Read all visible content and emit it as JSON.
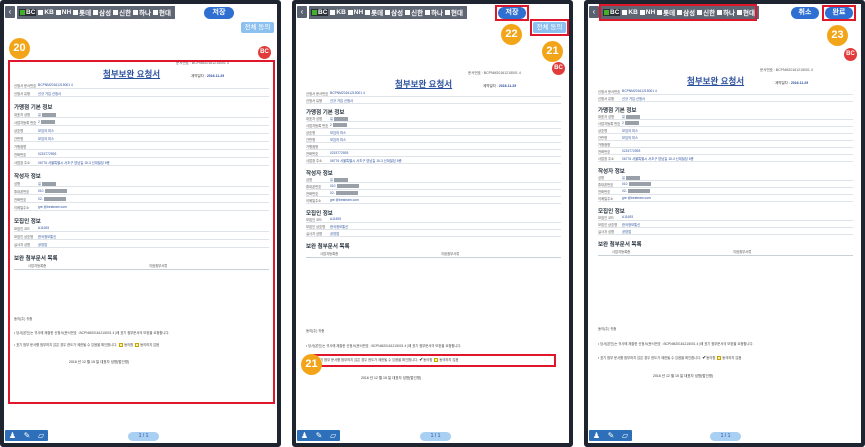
{
  "tabs": [
    {
      "label": "BC",
      "color": "#43b02a"
    },
    {
      "label": "KB",
      "color": "#ffffff"
    },
    {
      "label": "NH",
      "color": "#ffffff"
    },
    {
      "label": "롯데",
      "color": "#ffffff"
    },
    {
      "label": "삼성",
      "color": "#ffffff"
    },
    {
      "label": "신한",
      "color": "#ffffff"
    },
    {
      "label": "하나",
      "color": "#ffffff"
    },
    {
      "label": "현대",
      "color": "#ffffff"
    }
  ],
  "buttons": {
    "save": "저장",
    "agree_all": "전체 동의",
    "cancel": "취소",
    "done": "완료"
  },
  "logo_text": "BC",
  "doc": {
    "number": "문서번호 : BCPNM20161215001 4",
    "title": "첨부보완 요청서",
    "date_label": "계약일자 :",
    "date_value": "2016.11.29",
    "head_rows": [
      {
        "label": "신청서 문서번호",
        "value": "BCPNM20161215001 4"
      },
      {
        "label": "신청서 유형",
        "value": "신규 가입 신청서"
      }
    ],
    "sections": [
      {
        "title": "가맹점 기본 정보",
        "rows": [
          {
            "label": "대표자 성명",
            "value": "유"
          },
          {
            "label": "사업자등록 번호",
            "value": "2"
          },
          {
            "label": "상호명",
            "value": "모임의 미스"
          },
          {
            "label": "간판명",
            "value": "모임의 미스"
          },
          {
            "label": "가맹점명",
            "value": ""
          },
          {
            "label": "전화번호",
            "value": "0215772593"
          },
          {
            "label": "사업장 주소",
            "value": "06776   서울특별시 서초구 양남길 15-3              신대빌딩 5층"
          }
        ]
      },
      {
        "title": "작성자 정보",
        "rows": [
          {
            "label": "성명",
            "value": "유"
          },
          {
            "label": "휴대폰번호",
            "value": "010"
          },
          {
            "label": "전화번호",
            "value": "02-"
          },
          {
            "label": "이메일주소",
            "value": "gre          @besteam.com"
          }
        ]
      },
      {
        "title": "모집인 정보",
        "rows": [
          {
            "label": "모집인 코드",
            "value": "A11693"
          },
          {
            "label": "모집인 상호명",
            "value": "한국정보통신"
          },
          {
            "label": "실사자 성명",
            "value": "공영업"
          }
        ]
      },
      {
        "title": "보완 첨부문서 목록",
        "rows": [
          {
            "label": "사업자등록증",
            "value": "지점첨부서류"
          }
        ]
      }
    ],
    "consent_head": "동의(주) 귀중",
    "consent_line1": "• 당사(본인)는 귀사에 제출한 신청서(문서번호 : BCPNM20161215001 4        )에 표기 첨부문서의 보완을 요청합니다.",
    "consent_line2": "• 표기 첨부 문서를 첨부하지 않은 경우 한도가 제한될 수 있음을 확인합니다.",
    "agree": "동의함",
    "disagree": "동의하지 않음",
    "sign_date": "2016 년  12 월  15 일      대표자 성명(법인명)"
  },
  "pager": "1 / 1",
  "badges": {
    "b20": "20",
    "b21": "21",
    "b22": "22",
    "b23": "23"
  }
}
